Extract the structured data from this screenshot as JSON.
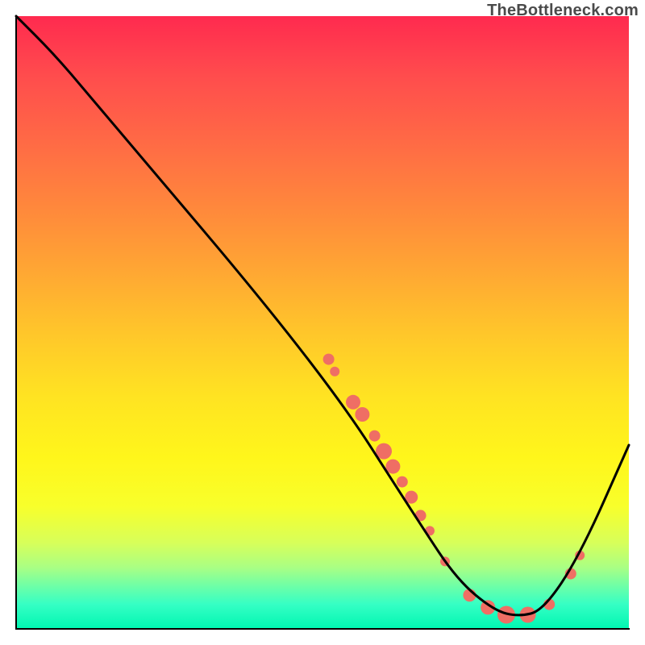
{
  "watermark": "TheBottleneck.com",
  "chart_data": {
    "type": "line",
    "title": "",
    "xlabel": "",
    "ylabel": "",
    "xlim": [
      0,
      100
    ],
    "ylim": [
      0,
      100
    ],
    "grid": false,
    "legend": false,
    "series": [
      {
        "name": "curve",
        "type": "line",
        "color": "#000000",
        "points": [
          {
            "x": 0,
            "y": 100
          },
          {
            "x": 6,
            "y": 94
          },
          {
            "x": 12,
            "y": 87
          },
          {
            "x": 50,
            "y": 42
          },
          {
            "x": 66,
            "y": 17
          },
          {
            "x": 72,
            "y": 8
          },
          {
            "x": 78,
            "y": 3
          },
          {
            "x": 82,
            "y": 2
          },
          {
            "x": 86,
            "y": 3
          },
          {
            "x": 92,
            "y": 12
          },
          {
            "x": 100,
            "y": 30
          }
        ]
      },
      {
        "name": "dots",
        "type": "scatter",
        "color": "#ef6e64",
        "points": [
          {
            "x": 51,
            "y": 44,
            "r": 7
          },
          {
            "x": 52,
            "y": 42,
            "r": 6
          },
          {
            "x": 55,
            "y": 37,
            "r": 9
          },
          {
            "x": 56.5,
            "y": 35,
            "r": 9
          },
          {
            "x": 58.5,
            "y": 31.5,
            "r": 7
          },
          {
            "x": 60,
            "y": 29,
            "r": 10
          },
          {
            "x": 61.5,
            "y": 26.5,
            "r": 9
          },
          {
            "x": 63,
            "y": 24,
            "r": 7
          },
          {
            "x": 64.5,
            "y": 21.5,
            "r": 8
          },
          {
            "x": 66,
            "y": 18.5,
            "r": 7
          },
          {
            "x": 67.5,
            "y": 16,
            "r": 6
          },
          {
            "x": 70,
            "y": 11,
            "r": 6
          },
          {
            "x": 74,
            "y": 5.5,
            "r": 8
          },
          {
            "x": 77,
            "y": 3.5,
            "r": 9
          },
          {
            "x": 80,
            "y": 2.3,
            "r": 11
          },
          {
            "x": 83.5,
            "y": 2.3,
            "r": 10
          },
          {
            "x": 87,
            "y": 4,
            "r": 7
          },
          {
            "x": 90.5,
            "y": 9,
            "r": 7
          },
          {
            "x": 92,
            "y": 12,
            "r": 6
          }
        ]
      }
    ]
  }
}
